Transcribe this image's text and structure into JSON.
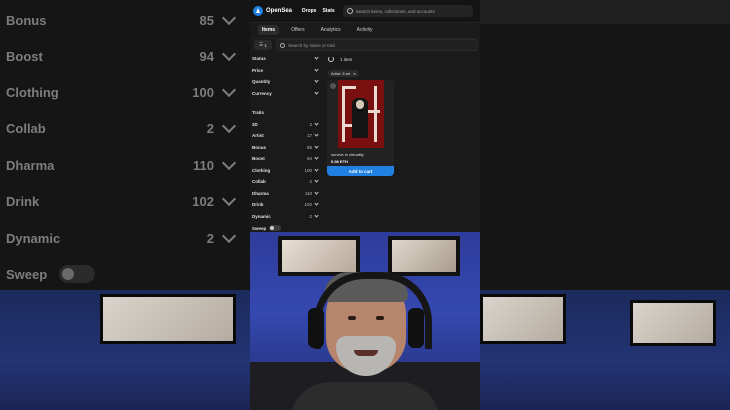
{
  "background": {
    "rows": [
      {
        "label": "Bonus",
        "count": "85"
      },
      {
        "label": "Boost",
        "count": "94"
      },
      {
        "label": "Clothing",
        "count": "100"
      },
      {
        "label": "Collab",
        "count": "2"
      },
      {
        "label": "Dharma",
        "count": "110"
      },
      {
        "label": "Drink",
        "count": "102"
      },
      {
        "label": "Dynamic",
        "count": "2"
      }
    ],
    "sweep_label": "Sweep"
  },
  "topbar": {
    "brand": "OpenSea",
    "nav": [
      "Drops",
      "Stats"
    ],
    "search_placeholder": "Search items, collections, and accounts"
  },
  "tabs": [
    "Items",
    "Offers",
    "Analytics",
    "Activity"
  ],
  "filter": {
    "count": "1",
    "search_placeholder": "Search by name or trait"
  },
  "sidebar": {
    "sections": [
      "Status",
      "Price",
      "Quantity",
      "Currency"
    ],
    "traits_heading": "Traits",
    "traits": [
      {
        "label": "3D",
        "count": "2"
      },
      {
        "label": "Artist",
        "count": "17"
      },
      {
        "label": "Bonus",
        "count": "85"
      },
      {
        "label": "Boost",
        "count": "94"
      },
      {
        "label": "Clothing",
        "count": "100"
      },
      {
        "label": "Collab",
        "count": "2"
      },
      {
        "label": "Dharma",
        "count": "110"
      },
      {
        "label": "Drink",
        "count": "102"
      },
      {
        "label": "Dynamic",
        "count": "2"
      }
    ],
    "sweep_label": "Sweep"
  },
  "results": {
    "count_text": "1 item",
    "chip": "Artist: 8 art"
  },
  "card": {
    "title": "survive in virtuality",
    "price": "0.08 ETH",
    "button": "Add to cart"
  },
  "colors": {
    "accent": "#2081e2",
    "panel": "#1a1a1a"
  }
}
